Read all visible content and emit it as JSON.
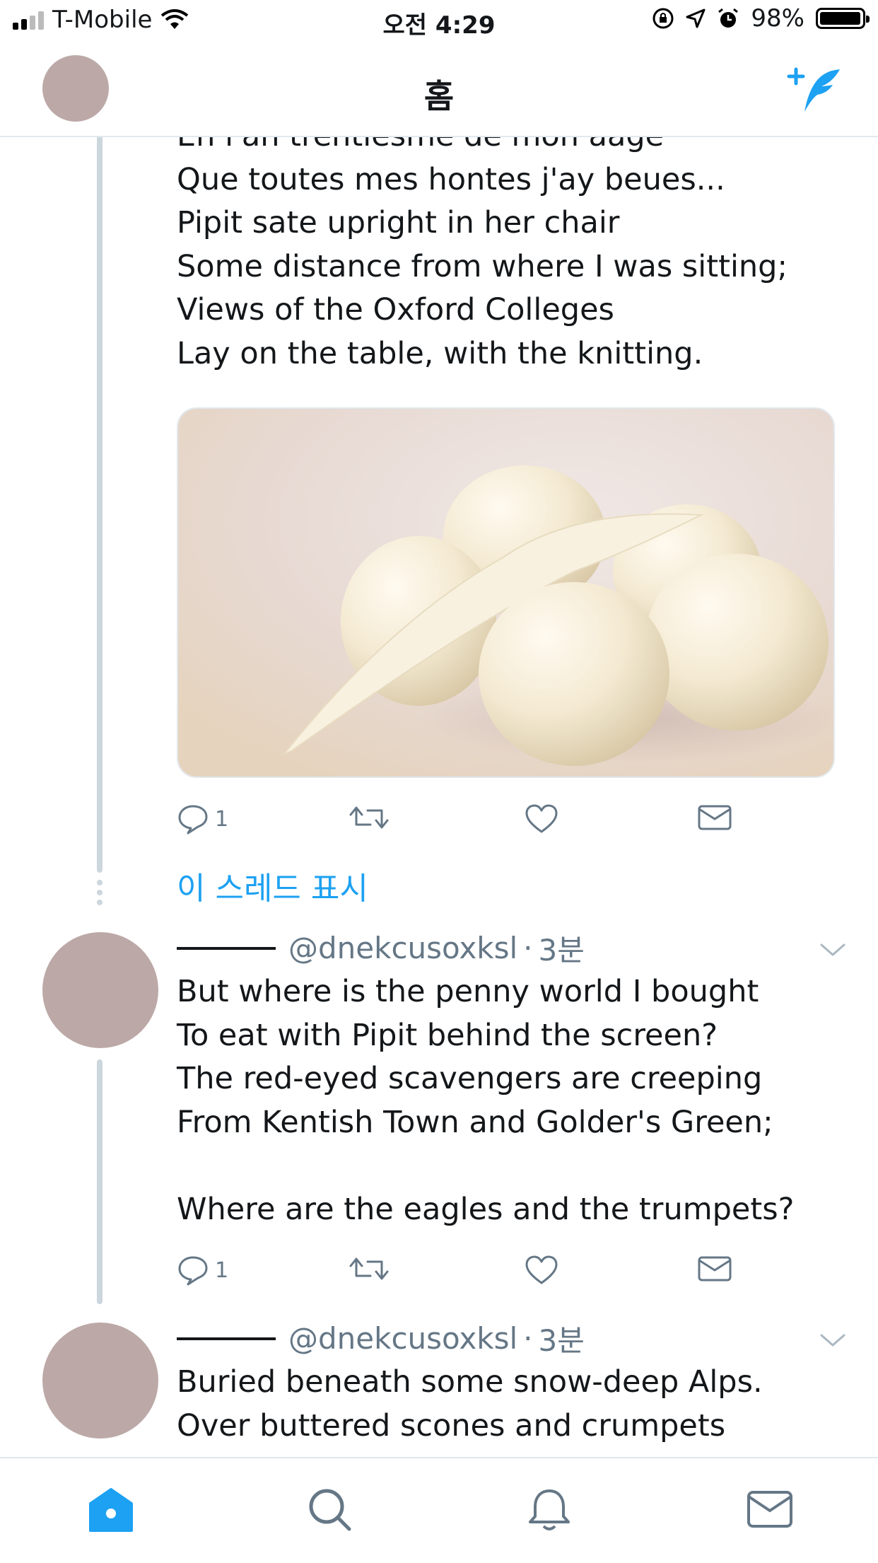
{
  "status_bar": {
    "carrier": "T-Mobile",
    "time": "오전 4:29",
    "battery": "98%",
    "battery_level": 0.98
  },
  "nav": {
    "title": "홈",
    "compose_icon": "compose-tweet-icon"
  },
  "tweets": [
    {
      "lines": "En l'an trentiesme de mon aage\nQue toutes mes hontes j'ay beues...\nPipit sate upright in her chair\nSome distance from where I was sitting;\nViews of the Oxford Colleges\nLay on the table, with the knitting.",
      "reply_count": "1"
    },
    {
      "handle": "@dnekcusoxksl",
      "separator": "·",
      "time": "3분",
      "lines": "But where is the penny world I bought\nTo eat with Pipit behind the screen?\nThe red-eyed scavengers are creeping\nFrom Kentish Town and Golder's Green;\n\nWhere are the eagles and the trumpets?",
      "reply_count": "1"
    },
    {
      "handle": "@dnekcusoxksl",
      "separator": "·",
      "time": "3분",
      "lines": "Buried beneath some snow-deep Alps.\nOver buttered scones and crumpets"
    }
  ],
  "show_thread": "이 스레드 표시",
  "tabs": [
    "home-icon",
    "search-icon",
    "notifications-icon",
    "messages-icon"
  ],
  "colors": {
    "accent": "#1da1f2",
    "avatar": "#bca9a7",
    "thread_line": "#ccd6dd",
    "secondary_text": "#657786"
  }
}
